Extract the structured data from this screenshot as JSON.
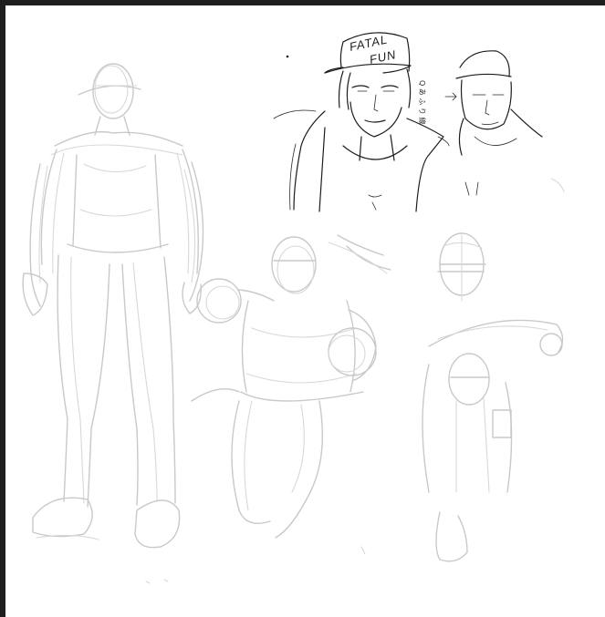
{
  "canvas": {
    "background": "#ffffff",
    "frame_color": "#1e1e1e",
    "sketch_color": "#c9c9c9",
    "ink_color": "#1c1c1c"
  },
  "ink_sketch": {
    "cap_text_line1": "FATAL",
    "cap_text_line2": "FUN",
    "side_note": "Q あ ふ り 線"
  }
}
